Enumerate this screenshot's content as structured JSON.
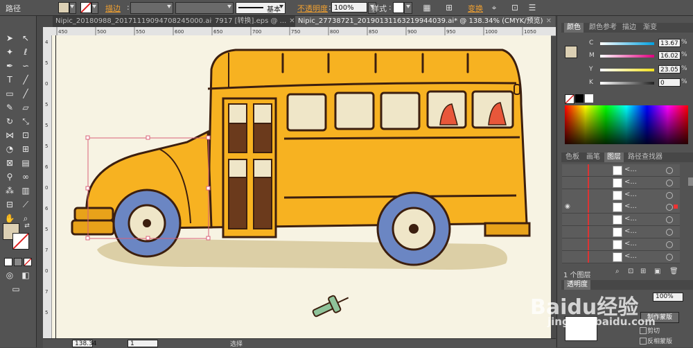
{
  "control_bar": {
    "object_type": "路径",
    "stroke_label": "描边",
    "stroke_profile": "基本",
    "opacity_label": "不透明度",
    "opacity_value": "100%",
    "style_label": "样式",
    "transform_label": "变换"
  },
  "tabs": [
    {
      "label": "Nipic_20180988_20171119094708245000.ai*",
      "close": "✕",
      "active": false
    },
    {
      "label": "7917 [转换].eps @ ...",
      "close": "✕",
      "active": false
    },
    {
      "label": "Nipic_27738721_20190131163219944039.ai* @ 138.34% (CMYK/预览)",
      "close": "✕",
      "active": true
    }
  ],
  "rulers": {
    "top_ticks": [
      "450",
      "500",
      "550",
      "600",
      "650",
      "700",
      "750",
      "800",
      "850",
      "900",
      "950",
      "1000",
      "1050"
    ],
    "left_ticks": [
      "4",
      "5",
      "0",
      "5",
      "5",
      "5",
      "6",
      "0",
      "6",
      "5",
      "7",
      "0",
      "7",
      "5"
    ]
  },
  "status": {
    "zoom": "138.34",
    "page": "1",
    "mode": "选择"
  },
  "color_panel": {
    "tabs": [
      "颜色",
      "颜色参考",
      "描边",
      "渐变"
    ],
    "channels": [
      {
        "label": "C",
        "value": "13.67",
        "unit": "%",
        "color": "#00a0e0"
      },
      {
        "label": "M",
        "value": "16.02",
        "unit": "%",
        "color": "#e0007f"
      },
      {
        "label": "Y",
        "value": "23.05",
        "unit": "%",
        "color": "#f0e020"
      },
      {
        "label": "K",
        "value": "0",
        "unit": "%",
        "color": "#222222"
      }
    ],
    "fill_color": "#dcd0b4"
  },
  "layers_panel": {
    "tabs": [
      "色板",
      "画笔",
      "图层",
      "路径查找器"
    ],
    "rows": [
      {
        "name": "<..."
      },
      {
        "name": "<..."
      },
      {
        "name": "<..."
      },
      {
        "name": "<..."
      },
      {
        "name": "<..."
      },
      {
        "name": "<..."
      },
      {
        "name": "<..."
      },
      {
        "name": "<..."
      }
    ],
    "footer_text": "1 个图层"
  },
  "transparency_panel": {
    "tab": "透明度",
    "opacity": "100%",
    "make_mask": "制作蒙版",
    "clip": "剪切",
    "invert_mask": "反相蒙版"
  },
  "watermark": {
    "brand": "Baidu经验",
    "url": "jingyan.baidu.com"
  }
}
